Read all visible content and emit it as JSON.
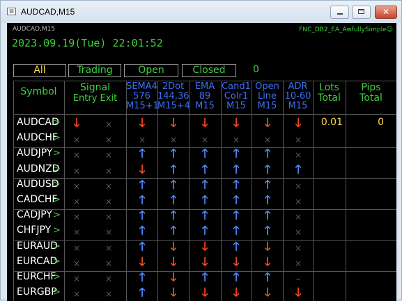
{
  "window": {
    "title": "AUDCAD,M15",
    "app_icon": "chart-app-icon"
  },
  "panel": {
    "symbol_label": "AUDCAD,M15",
    "ea_label": "FNC_DB2_EA_AwfullySimple☺",
    "datetime": "2023.09.19(Tue) 22:01:52",
    "tabs": [
      "All",
      "Trading",
      "Open",
      "Closed"
    ],
    "count": "0"
  },
  "headers": [
    [
      "Symbol"
    ],
    [
      "Signal",
      "Entry Exit"
    ],
    [
      "SEMA4",
      "576",
      "M15+1"
    ],
    [
      "2Dot",
      "144,36",
      "M15+4"
    ],
    [
      "EMA",
      "89",
      "M15"
    ],
    [
      "Cand1",
      "Colr1",
      "M15"
    ],
    [
      "Open",
      "Line",
      "M15"
    ],
    [
      "ADR",
      "10-60",
      "M15"
    ],
    [
      "Lots",
      "Total"
    ],
    [
      "Pips",
      "Total"
    ]
  ],
  "colors": {
    "green": "#3fcf3f",
    "up": "#4f8bff",
    "down": "#ff4a1c",
    "gold": "#ffd84a"
  },
  "rows": [
    {
      "symbol": "AUDCAD",
      "cells": [
        "down",
        "x",
        "down",
        "down",
        "down",
        "down",
        "down",
        "down"
      ],
      "lots": "0.01",
      "pips": "0"
    },
    {
      "symbol": "AUDCHF",
      "cells": [
        "x",
        "x",
        "x",
        "x",
        "x",
        "x",
        "x",
        "x"
      ]
    },
    {
      "symbol": "AUDJPY",
      "cells": [
        "x",
        "x",
        "up",
        "up",
        "up",
        "up",
        "up",
        "x"
      ]
    },
    {
      "symbol": "AUDNZD",
      "cells": [
        "x",
        "x",
        "down",
        "up",
        "up",
        "up",
        "up",
        "up"
      ]
    },
    {
      "symbol": "AUDUSD",
      "cells": [
        "x",
        "x",
        "up",
        "up",
        "up",
        "up",
        "up",
        "x"
      ]
    },
    {
      "symbol": "CADCHF",
      "cells": [
        "x",
        "x",
        "up",
        "up",
        "up",
        "up",
        "up",
        "x"
      ]
    },
    {
      "symbol": "CADJPY",
      "cells": [
        "x",
        "x",
        "up",
        "up",
        "up",
        "up",
        "up",
        "x"
      ]
    },
    {
      "symbol": "CHFJPY",
      "cells": [
        "x",
        "x",
        "up",
        "up",
        "up",
        "up",
        "up",
        "x"
      ]
    },
    {
      "symbol": "EURAUD",
      "cells": [
        "x",
        "x",
        "up",
        "down",
        "down",
        "up",
        "down",
        "x"
      ]
    },
    {
      "symbol": "EURCAD",
      "cells": [
        "x",
        "x",
        "down",
        "down",
        "down",
        "down",
        "down",
        "x"
      ]
    },
    {
      "symbol": "EURCHF",
      "cells": [
        "x",
        "x",
        "up",
        "down",
        "up",
        "up",
        "up",
        "dash"
      ]
    },
    {
      "symbol": "EURGBP",
      "cells": [
        "x",
        "x",
        "up",
        "down",
        "down",
        "down",
        "down",
        "down"
      ]
    }
  ]
}
